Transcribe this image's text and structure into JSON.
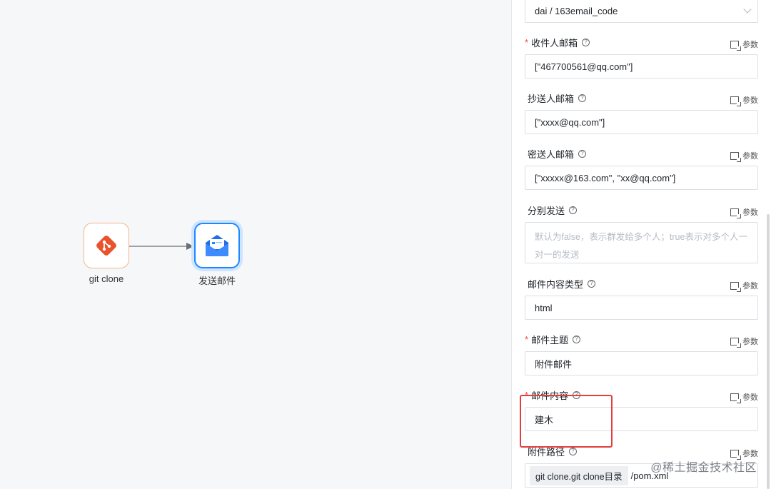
{
  "canvas": {
    "nodes": [
      {
        "label": "git clone",
        "icon": "git-icon",
        "color": "#e8532c"
      },
      {
        "label": "发送邮件",
        "icon": "mail-icon",
        "color": "#1e88ff"
      }
    ]
  },
  "panel": {
    "credential": {
      "value": "dai / 163email_code"
    },
    "param_label": "参数",
    "fields": [
      {
        "label": "收件人邮箱",
        "required": "*",
        "value": "[\"467700561@qq.com\"]"
      },
      {
        "label": "抄送人邮箱",
        "required": "",
        "value": "[\"xxxx@qq.com\"]"
      },
      {
        "label": "密送人邮箱",
        "required": "",
        "value": "[\"xxxxx@163.com\", \"xx@qq.com\"]"
      },
      {
        "label": "分别发送",
        "required": "",
        "placeholder": "默认为false，表示群发给多个人；true表示对多个人一对一的发送"
      },
      {
        "label": "邮件内容类型",
        "required": "",
        "value": "html"
      },
      {
        "label": "邮件主题",
        "required": "*",
        "value": "附件邮件"
      },
      {
        "label": "邮件内容",
        "required": "*",
        "value": "建木"
      },
      {
        "label": "附件路径",
        "required": "",
        "tag": "git clone.git clone目录",
        "value": "/pom.xml"
      }
    ]
  },
  "watermark": "@稀土掘金技术社区"
}
